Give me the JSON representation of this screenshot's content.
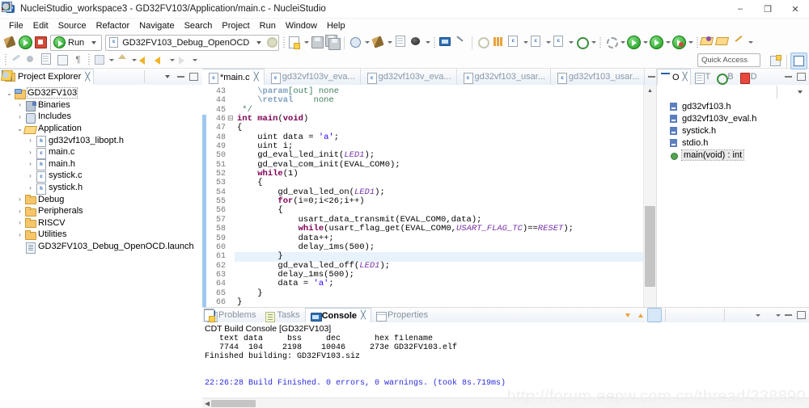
{
  "window": {
    "title": "NucleiStudio_workspace3 - GD32FV103/Application/main.c - NucleiStudio",
    "minimize": "–",
    "maximize": "❐",
    "close": "✕"
  },
  "menu": [
    "File",
    "Edit",
    "Source",
    "Refactor",
    "Navigate",
    "Search",
    "Project",
    "Run",
    "Window",
    "Help"
  ],
  "toolbar": {
    "run_mode": "Run",
    "launch_config": "GD32FV103_Debug_OpenOCD",
    "quick_access": "Quick Access"
  },
  "project_explorer": {
    "tab_label": "Project Explorer",
    "close_glyph": "╳",
    "tree": [
      {
        "depth": 0,
        "arrow": "⌄",
        "icon": "project-icon",
        "label": "GD32FV103",
        "selected": true
      },
      {
        "depth": 1,
        "arrow": "›",
        "icon": "binaries-icon",
        "label": "Binaries"
      },
      {
        "depth": 1,
        "arrow": "›",
        "icon": "includes-icon",
        "label": "Includes"
      },
      {
        "depth": 1,
        "arrow": "⌄",
        "icon": "folder-open-icon",
        "label": "Application"
      },
      {
        "depth": 2,
        "arrow": "›",
        "icon": "h-file-icon",
        "label": "gd32vf103_libopt.h"
      },
      {
        "depth": 2,
        "arrow": "›",
        "icon": "c-file-icon",
        "label": "main.c"
      },
      {
        "depth": 2,
        "arrow": "›",
        "icon": "h-file-icon",
        "label": "main.h"
      },
      {
        "depth": 2,
        "arrow": "›",
        "icon": "c-file-icon",
        "label": "systick.c"
      },
      {
        "depth": 2,
        "arrow": "›",
        "icon": "h-file-icon",
        "label": "systick.h"
      },
      {
        "depth": 1,
        "arrow": "›",
        "icon": "folder-icon",
        "label": "Debug"
      },
      {
        "depth": 1,
        "arrow": "›",
        "icon": "folder-icon",
        "label": "Peripherals"
      },
      {
        "depth": 1,
        "arrow": "›",
        "icon": "folder-icon",
        "label": "RISCV"
      },
      {
        "depth": 1,
        "arrow": "›",
        "icon": "folder-icon",
        "label": "Utilities"
      },
      {
        "depth": 1,
        "arrow": "",
        "icon": "launch-file-icon",
        "label": "GD32FV103_Debug_OpenOCD.launch"
      }
    ]
  },
  "editor": {
    "tabs": [
      {
        "label": "*main.c",
        "active": true,
        "close": "╳"
      },
      {
        "label": "gd32vf103v_eva...",
        "active": false
      },
      {
        "label": "gd32vf103v_eva...",
        "active": false
      },
      {
        "label": "gd32vf103_usar...",
        "active": false
      },
      {
        "label": "gd32vf103_usar...",
        "active": false
      }
    ],
    "first_line": 43,
    "highlight_line": 61,
    "lines": [
      {
        "n": 43,
        "html": "    <span class='cmtag'>\\param</span><span class='cm'>[out] none</span>"
      },
      {
        "n": 44,
        "html": "    <span class='cmtag'>\\retval</span><span class='cm'>    none</span>"
      },
      {
        "n": 45,
        "html": "<span class='cm'> */</span>"
      },
      {
        "n": 46,
        "html": "<span class='kw'>int</span> <span class='kw'>main</span>(<span class='kw'>void</span>)",
        "fold": true,
        "marked": true
      },
      {
        "n": 47,
        "html": "{",
        "marked": true
      },
      {
        "n": 48,
        "html": "    uint data = <span class='str'>'a'</span>;",
        "marked": true
      },
      {
        "n": 49,
        "html": "    uint i;",
        "marked": true
      },
      {
        "n": 50,
        "html": "    gd_eval_led_init(<span class='mac'>LED1</span>);",
        "marked": true
      },
      {
        "n": 51,
        "html": "    gd_eval_com_init(EVAL_COM0);",
        "marked": true
      },
      {
        "n": 52,
        "html": "    <span class='kw'>while</span>(1)",
        "marked": true
      },
      {
        "n": 53,
        "html": "    {",
        "marked": true
      },
      {
        "n": 54,
        "html": "        gd_eval_led_on(<span class='mac'>LED1</span>);",
        "marked": true
      },
      {
        "n": 55,
        "html": "        <span class='kw'>for</span>(i=0;i&lt;26;i++)",
        "marked": true
      },
      {
        "n": 56,
        "html": "        {",
        "marked": true
      },
      {
        "n": 57,
        "html": "            usart_data_transmit(EVAL_COM0,data);",
        "marked": true
      },
      {
        "n": 58,
        "html": "            <span class='kw'>while</span>(usart_flag_get(EVAL_COM0,<span class='mac'>USART_FLAG_TC</span>)==<span class='mac'>RESET</span>);",
        "marked": true
      },
      {
        "n": 59,
        "html": "            data++;",
        "marked": true
      },
      {
        "n": 60,
        "html": "            delay_1ms(500);",
        "marked": true
      },
      {
        "n": 61,
        "html": "        }",
        "marked": true,
        "highlight": true
      },
      {
        "n": 62,
        "html": "        gd_eval_led_off(<span class='mac'>LED1</span>);",
        "marked": true
      },
      {
        "n": 63,
        "html": "        delay_1ms(500);",
        "marked": true
      },
      {
        "n": 64,
        "html": "        data = <span class='str'>'a'</span>;",
        "marked": true
      },
      {
        "n": 65,
        "html": "    }",
        "marked": true
      },
      {
        "n": 66,
        "html": "}",
        "marked": true
      }
    ]
  },
  "outline": {
    "tabs": [
      {
        "label": "O",
        "icon": "outline-icon",
        "active": true,
        "close": "╳"
      },
      {
        "label": "T",
        "icon": "task-list-icon",
        "active": false
      },
      {
        "label": "B",
        "icon": "build-targets-icon",
        "active": false
      },
      {
        "label": "D",
        "icon": "documents-icon",
        "active": false
      }
    ],
    "items": [
      {
        "icon": "header-icon",
        "label": "gd32vf103.h"
      },
      {
        "icon": "header-icon",
        "label": "gd32vf103v_eval.h"
      },
      {
        "icon": "header-icon",
        "label": "systick.h"
      },
      {
        "icon": "header-icon",
        "label": "stdio.h"
      },
      {
        "icon": "function-icon",
        "label": "main(void) : int",
        "selected": true
      }
    ]
  },
  "console": {
    "tabs": [
      {
        "label": "Problems",
        "icon": "problems-icon",
        "active": false
      },
      {
        "label": "Tasks",
        "icon": "tasks-icon",
        "active": false
      },
      {
        "label": "Console",
        "icon": "console-icon",
        "active": true,
        "close": "╳"
      },
      {
        "label": "Properties",
        "icon": "properties-icon",
        "active": false
      }
    ],
    "header": "CDT Build Console [GD32FV103]",
    "output": [
      {
        "text": "   text\tdata\t bss\t dec\t   hex filename",
        "blue": false
      },
      {
        "text": "   7744\t 104\t2198\t10046\t  273e GD32FV103.elf",
        "blue": false
      },
      {
        "text": "Finished building: GD32FV103.siz",
        "blue": false
      },
      {
        "text": "",
        "blue": false
      },
      {
        "text": "",
        "blue": false
      },
      {
        "text": "22:26:28 Build Finished. 0 errors, 0 warnings. (took 8s.719ms)",
        "blue": true
      }
    ]
  },
  "watermark": "http://forum.eepw.com.cn/thread/338890"
}
